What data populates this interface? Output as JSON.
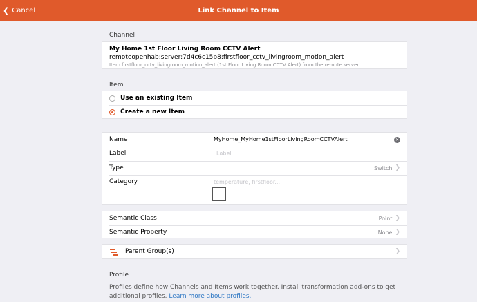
{
  "navbar": {
    "back_label": "Cancel",
    "title": "Link Channel to Item"
  },
  "channel": {
    "section_title": "Channel",
    "name": "My Home 1st Floor Living Room CCTV Alert",
    "uid": "remoteopenhab:server:7d4c6c15b8:firstfloor_cctv_livingroom_motion_alert",
    "description": "Item firstfloor_cctv_livingroom_motion_alert (1st Floor Living Room CCTV Alert) from the remote server."
  },
  "item": {
    "section_title": "Item",
    "options": [
      {
        "label": "Use an existing Item",
        "selected": false
      },
      {
        "label": "Create a new Item",
        "selected": true
      }
    ]
  },
  "form": {
    "name": {
      "label": "Name",
      "value": "MyHome_MyHome1stFloorLivingRoomCCTVAlert"
    },
    "label": {
      "label": "Label",
      "placeholder": "Label"
    },
    "type": {
      "label": "Type",
      "value": "Switch"
    },
    "category": {
      "label": "Category",
      "placeholder": "temperature, firstfloor..."
    }
  },
  "semantic": {
    "class": {
      "label": "Semantic Class",
      "value": "Point"
    },
    "property": {
      "label": "Semantic Property",
      "value": "None"
    }
  },
  "parent_group": {
    "label": "Parent Group(s)"
  },
  "profile": {
    "section_title": "Profile",
    "description": "Profiles define how Channels and Items work together. Install transformation add-ons to get additional profiles.",
    "link_text": "Learn more about profiles."
  },
  "colors": {
    "accent": "#e05a2b",
    "link": "#2f78c4"
  },
  "icons": {
    "back": "chevron-left-icon",
    "clear": "clear-icon",
    "chevron": "chevron-right-icon",
    "parent_group": "list-icon"
  }
}
